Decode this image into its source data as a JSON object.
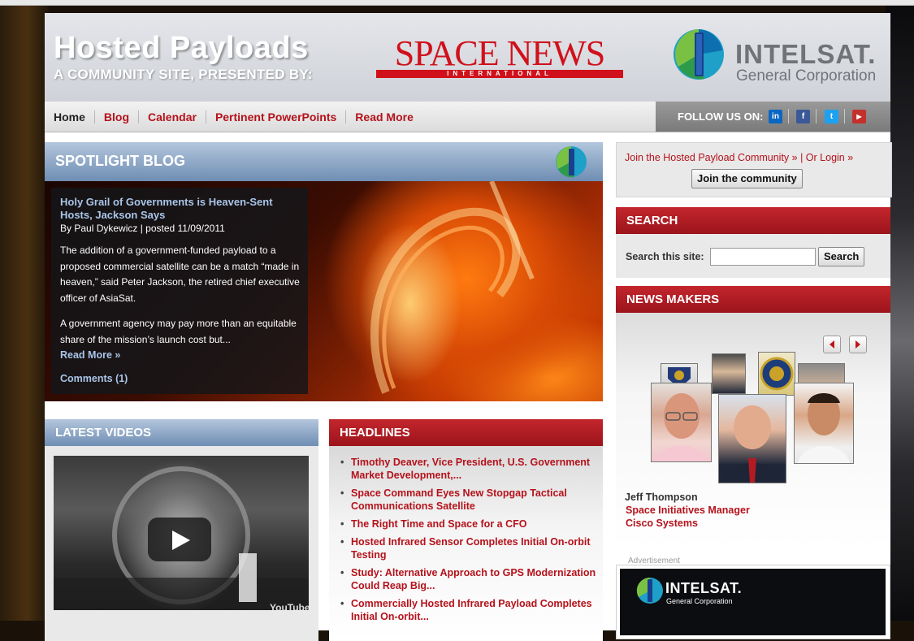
{
  "header": {
    "title": "Hosted Payloads",
    "subtitle": "A COMMUNITY SITE, PRESENTED BY:",
    "sponsor_logo_main": "SPACE NEWS",
    "sponsor_logo_sub": "INTERNATIONAL",
    "partner_name": "INTELSAT.",
    "partner_sub": "General Corporation"
  },
  "nav": {
    "items": [
      "Home",
      "Blog",
      "Calendar",
      "Pertinent PowerPoints",
      "Read More"
    ],
    "follow_label": "FOLLOW US ON:",
    "social": [
      "linkedin-icon",
      "facebook-icon",
      "twitter-icon",
      "youtube-icon"
    ]
  },
  "spotlight": {
    "section_title": "SPOTLIGHT BLOG",
    "headline": "Holy Grail of Governments is Heaven-Sent Hosts, Jackson Says",
    "byline": "By Paul Dykewicz | posted 11/09/2011",
    "paragraph1": "The addition of a government-funded payload to a proposed commercial satellite can be a match “made in heaven,” said Peter Jackson, the retired chief executive officer of AsiaSat.",
    "paragraph2": "A government agency may pay more than an equitable share of the mission’s launch cost but...",
    "read_more": "Read More »",
    "comments": "Comments (1)"
  },
  "community": {
    "join_text": "Join the Hosted Payload Community » | Or Login »",
    "join_button": "Join the community"
  },
  "search": {
    "section_title": "SEARCH",
    "label": "Search this site:",
    "value": "",
    "button": "Search"
  },
  "news_makers": {
    "section_title": "NEWS MAKERS",
    "name": "Jeff Thompson",
    "title": "Space Initiatives Manager",
    "org": "Cisco Systems"
  },
  "ad": {
    "label": "Advertisement",
    "name": "INTELSAT.",
    "sub": "General Corporation"
  },
  "videos": {
    "section_title": "LATEST VIDEOS",
    "watermark": "YouTube"
  },
  "headlines": {
    "section_title": "HEADLINES",
    "items": [
      "Timothy Deaver, Vice President, U.S. Government Market Development,...",
      "Space Command Eyes New Stopgap Tactical Communications Satellite",
      "The Right Time and Space for a CFO",
      "Hosted Infrared Sensor Completes Initial On-orbit Testing",
      "Study: Alternative Approach to GPS Modernization Could Reap Big...",
      "Commercially Hosted Infrared Payload Completes Initial On-orbit..."
    ]
  },
  "colors": {
    "accent_red": "#b5121b",
    "header_blue": "#6f8db3",
    "link_blue": "#a9c5e8"
  }
}
